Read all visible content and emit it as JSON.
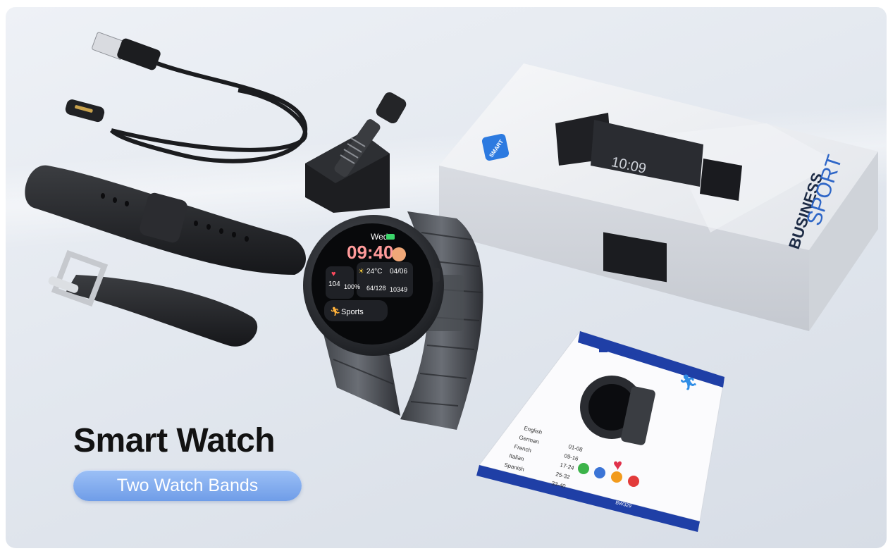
{
  "headline": "Smart Watch",
  "badge": "Two Watch Bands",
  "watch_face": {
    "day": "Wed",
    "time": "09:40",
    "temperature": "24°C",
    "date": "04/06",
    "heart_rate": "104",
    "blood_oxygen": "100%",
    "blood_pressure": "64/128",
    "steps": "10349",
    "activity": "Sports"
  },
  "box": {
    "brand": "SMART",
    "line1": "BUSINESS",
    "line2": "SPORT",
    "screen_time": "10:09"
  },
  "manual": {
    "brand": "SMART",
    "languages": [
      "English",
      "German",
      "French",
      "Italian",
      "Spanish"
    ],
    "pages": [
      "01-08",
      "09-16",
      "17-24",
      "25-32",
      "33-40"
    ],
    "model": "BW329"
  },
  "colors": {
    "badge_gradient_top": "#9cc0f6",
    "badge_gradient_bottom": "#6f9de8",
    "manual_stripe": "#1f3fa6",
    "box_badge": "#2c7ae0"
  }
}
